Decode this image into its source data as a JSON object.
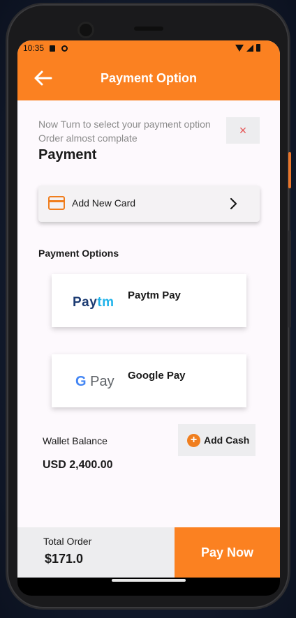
{
  "status_bar": {
    "time": "10:35"
  },
  "app_bar": {
    "title": "Payment Option",
    "back_icon": "arrow-left-icon"
  },
  "intro": {
    "line1": "Now Turn to select your payment option",
    "line2": "Order almost complate",
    "title": "Payment",
    "close_label": "×"
  },
  "add_card": {
    "label": "Add New Card",
    "icon": "credit-card-icon"
  },
  "payment_options": {
    "heading": "Payment Options",
    "items": [
      {
        "label": "Paytm Pay",
        "logo": "Paytm"
      },
      {
        "label": "Google Pay",
        "logo": "G Pay"
      }
    ]
  },
  "wallet": {
    "label": "Wallet Balance",
    "balance": "USD 2,400.00",
    "add_cash_label": "Add Cash"
  },
  "footer": {
    "total_label": "Total Order",
    "total_value": "$171.0",
    "pay_label": "Pay Now"
  },
  "colors": {
    "accent": "#fb8121",
    "close": "#e65454",
    "card_icon": "#f07e1e"
  }
}
